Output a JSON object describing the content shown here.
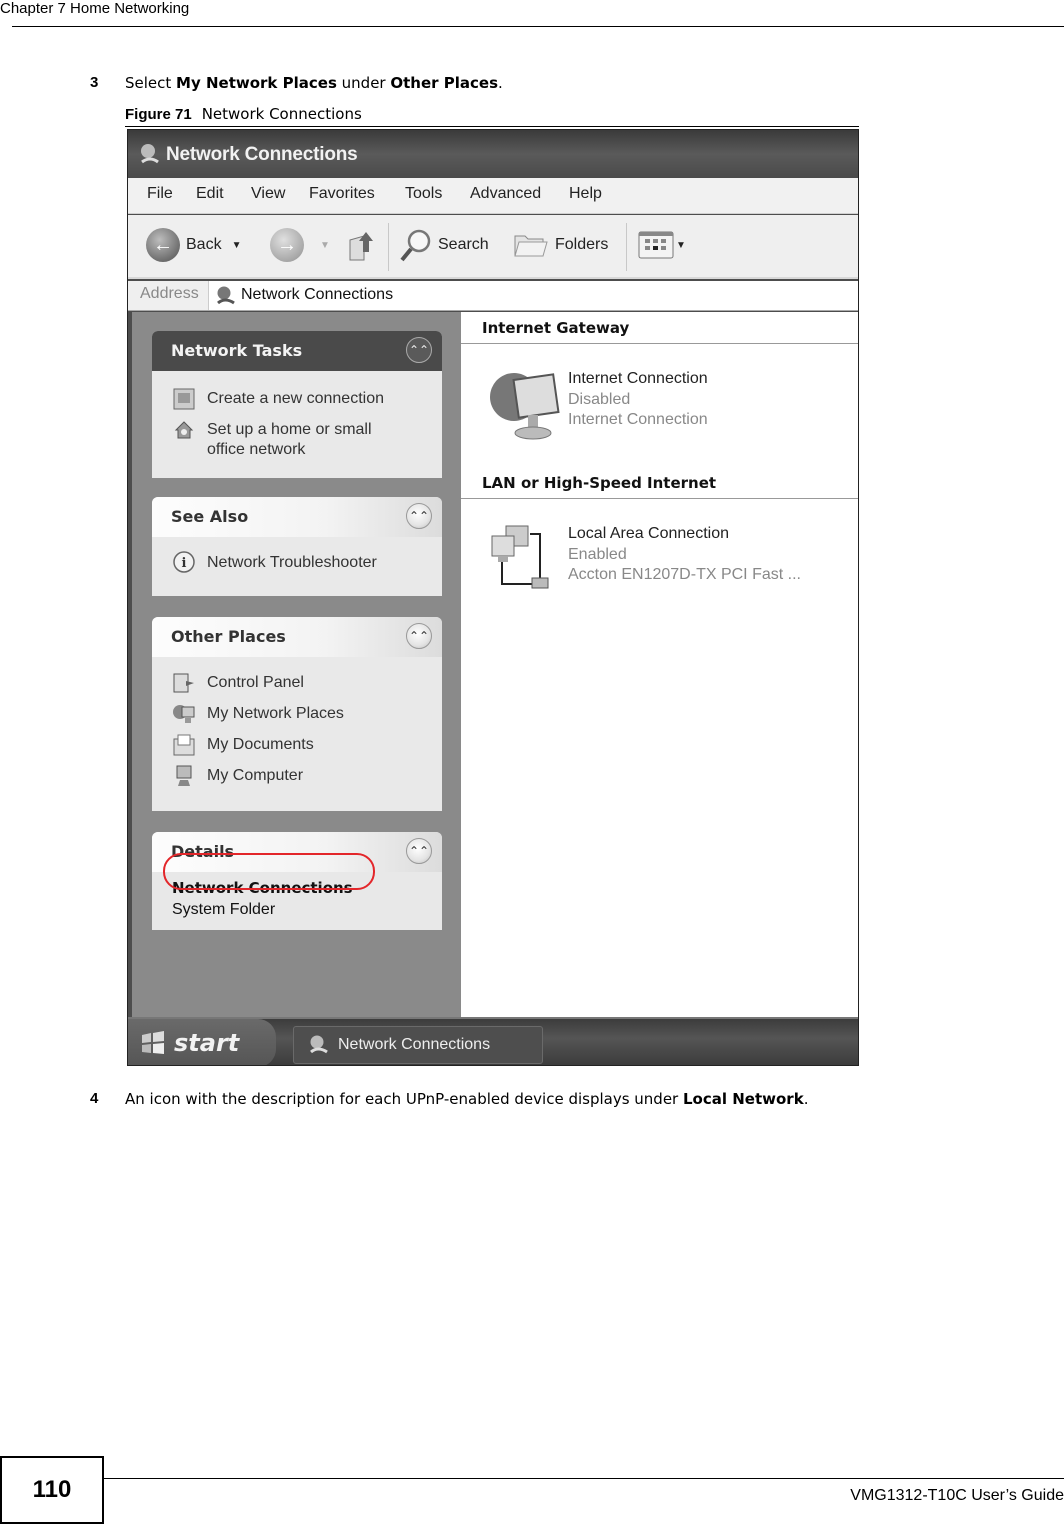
{
  "page": {
    "chapter_header": "Chapter 7 Home Networking",
    "page_number": "110",
    "guide_title": "VMG1312-T10C User’s Guide"
  },
  "steps": [
    {
      "number": "3",
      "parts": [
        {
          "text": "Select ",
          "bold": false
        },
        {
          "text": "My Network Places",
          "bold": true
        },
        {
          "text": " under ",
          "bold": false
        },
        {
          "text": "Other Places",
          "bold": true
        },
        {
          "text": ".",
          "bold": false
        }
      ]
    },
    {
      "number": "4",
      "parts": [
        {
          "text": "An icon with the description for each UPnP-enabled device displays under ",
          "bold": false
        },
        {
          "text": "Local Network",
          "bold": true
        },
        {
          "text": ".",
          "bold": false
        }
      ]
    }
  ],
  "figure": {
    "label": "Figure 71",
    "caption": "Network Connections"
  },
  "window": {
    "title": "Network Connections",
    "menu": [
      "File",
      "Edit",
      "View",
      "Favorites",
      "Tools",
      "Advanced",
      "Help"
    ],
    "toolbar": {
      "back": "Back",
      "search": "Search",
      "folders": "Folders"
    },
    "address": {
      "label": "Address",
      "value": "Network Connections"
    },
    "panels": {
      "network_tasks": {
        "title": "Network Tasks",
        "items": [
          "Create a new connection",
          "Set up a home or small office network"
        ]
      },
      "see_also": {
        "title": "See Also",
        "items": [
          "Network Troubleshooter"
        ]
      },
      "other_places": {
        "title": "Other Places",
        "items": [
          "Control Panel",
          "My Network Places",
          "My Documents",
          "My Computer"
        ],
        "highlighted": "My Network Places"
      },
      "details": {
        "title": "Details",
        "name": "Network Connections",
        "type": "System Folder"
      }
    },
    "groups": [
      {
        "title": "Internet Gateway",
        "connections": [
          {
            "name": "Internet Connection",
            "status": "Disabled",
            "device": "Internet Connection"
          }
        ]
      },
      {
        "title": "LAN or High-Speed Internet",
        "connections": [
          {
            "name": "Local Area Connection",
            "status": "Enabled",
            "device": "Accton EN1207D-TX PCI Fast ..."
          }
        ]
      }
    ],
    "taskbar": {
      "start": "start",
      "task": "Network Connections"
    },
    "colors": {
      "highlight_ring": "#e3262a"
    }
  }
}
